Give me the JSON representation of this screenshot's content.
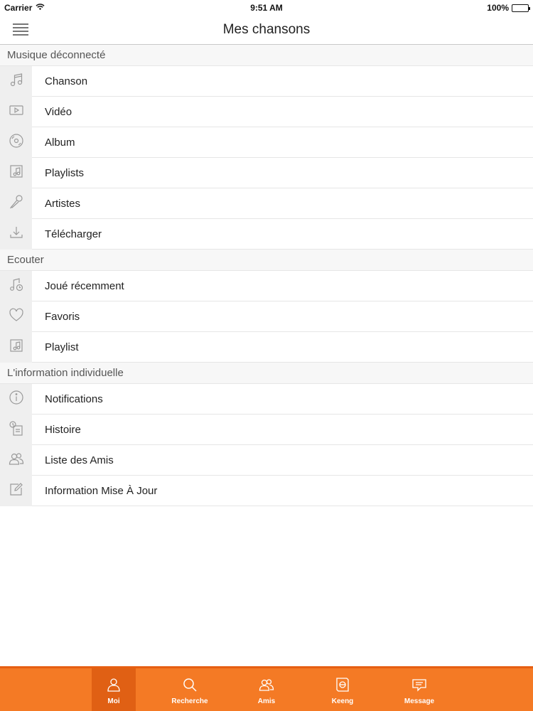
{
  "status_bar": {
    "carrier": "Carrier",
    "time": "9:51 AM",
    "battery": "100%"
  },
  "nav": {
    "title": "Mes chansons"
  },
  "sections": [
    {
      "header": "Musique déconnecté",
      "items": [
        {
          "label": "Chanson",
          "icon": "music-note-icon"
        },
        {
          "label": "Vidéo",
          "icon": "video-icon"
        },
        {
          "label": "Album",
          "icon": "disc-icon"
        },
        {
          "label": "Playlists",
          "icon": "playlist-icon"
        },
        {
          "label": "Artistes",
          "icon": "microphone-icon"
        },
        {
          "label": "Télécharger",
          "icon": "download-icon"
        }
      ]
    },
    {
      "header": "Ecouter",
      "items": [
        {
          "label": "Joué récemment",
          "icon": "recent-music-icon"
        },
        {
          "label": "Favoris",
          "icon": "heart-icon"
        },
        {
          "label": "Playlist",
          "icon": "playlist-icon"
        }
      ]
    },
    {
      "header": "L'information individuelle",
      "items": [
        {
          "label": "Notifications",
          "icon": "info-icon"
        },
        {
          "label": "Histoire",
          "icon": "history-icon"
        },
        {
          "label": "Liste des Amis",
          "icon": "friends-icon"
        },
        {
          "label": "Information  Mise À Jour",
          "icon": "edit-icon"
        }
      ]
    }
  ],
  "tabbar": {
    "tabs": [
      {
        "label": "Moi",
        "icon": "user-icon",
        "active": true
      },
      {
        "label": "Recherche",
        "icon": "search-icon"
      },
      {
        "label": "Amis",
        "icon": "friends-icon"
      },
      {
        "label": "Keeng",
        "icon": "keeng-icon"
      },
      {
        "label": "Message",
        "icon": "message-icon"
      }
    ]
  },
  "colors": {
    "accent": "#f47a25",
    "active_tab": "#e06014",
    "icon_gray": "#9a9a9a"
  }
}
